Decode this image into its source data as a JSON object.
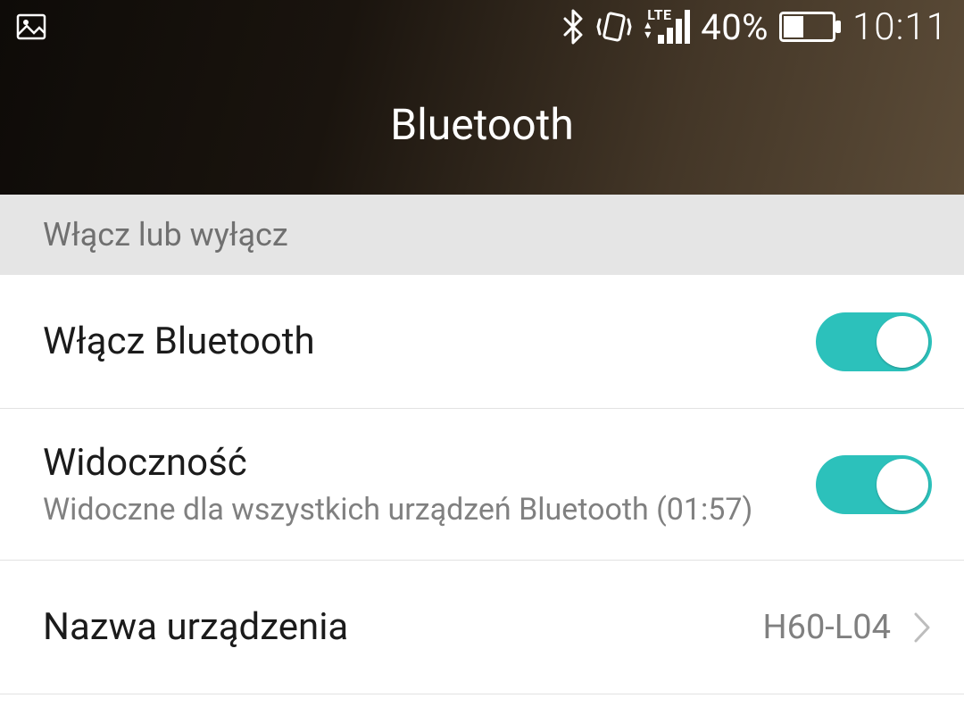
{
  "status": {
    "battery_text": "40%",
    "clock": "10:11",
    "network_label": "LTE"
  },
  "page_title": "Bluetooth",
  "section_header": "Włącz lub wyłącz",
  "rows": {
    "enable": {
      "title": "Włącz Bluetooth",
      "toggle_on": true
    },
    "visibility": {
      "title": "Widoczność",
      "subtitle": "Widoczne dla wszystkich urządzeń Bluetooth (01:57)",
      "toggle_on": true
    },
    "device_name": {
      "title": "Nazwa urządzenia",
      "value": "H60-L04"
    }
  },
  "colors": {
    "accent": "#2cc1bb",
    "header_gradient_start": "#0e0b08",
    "header_gradient_end": "#5c4c38",
    "subtext": "#808080"
  }
}
